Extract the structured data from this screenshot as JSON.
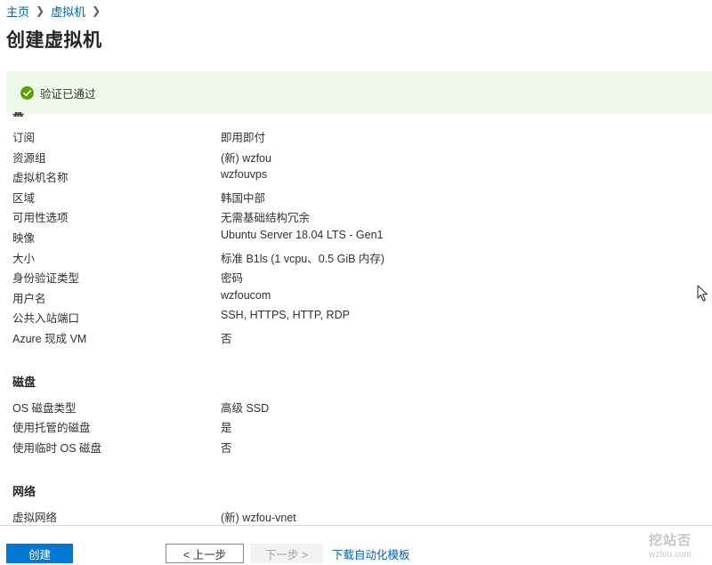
{
  "breadcrumb": {
    "home": "主页",
    "vm": "虚拟机"
  },
  "page_title": "创建虚拟机",
  "validation": {
    "message": "验证已通过",
    "color": "#57a300"
  },
  "basics": [
    {
      "label": "订阅",
      "value": "即用即付"
    },
    {
      "label": "资源组",
      "value": "(新) wzfou"
    },
    {
      "label": "虚拟机名称",
      "value": "wzfouvps"
    },
    {
      "label": "区域",
      "value": "韩国中部"
    },
    {
      "label": "可用性选项",
      "value": "无需基础结构冗余"
    },
    {
      "label": "映像",
      "value": "Ubuntu Server 18.04 LTS - Gen1"
    },
    {
      "label": "大小",
      "value": "标准 B1ls (1 vcpu、0.5 GiB 内存)"
    },
    {
      "label": "身份验证类型",
      "value": "密码"
    },
    {
      "label": "用户名",
      "value": "wzfoucom"
    },
    {
      "label": "公共入站端口",
      "value": "SSH, HTTPS, HTTP, RDP"
    },
    {
      "label": "Azure 现成 VM",
      "value": "否"
    }
  ],
  "disks": {
    "title": "磁盘",
    "rows": [
      {
        "label": "OS 磁盘类型",
        "value": "高级 SSD"
      },
      {
        "label": "使用托管的磁盘",
        "value": "是"
      },
      {
        "label": "使用临时 OS 磁盘",
        "value": "否"
      }
    ]
  },
  "network": {
    "title": "网络",
    "rows": [
      {
        "label": "虚拟网络",
        "value": "(新) wzfou-vnet"
      }
    ]
  },
  "footer": {
    "create": "创建",
    "prev": "< 上一步",
    "next": "下一步 >",
    "download_template": "下载自动化模板"
  },
  "watermark": {
    "line1": "挖站否",
    "line2": "wzfou.com"
  },
  "colors": {
    "accent": "#0078d4",
    "link": "#0062ad",
    "banner_bg": "#f0f8ea"
  }
}
